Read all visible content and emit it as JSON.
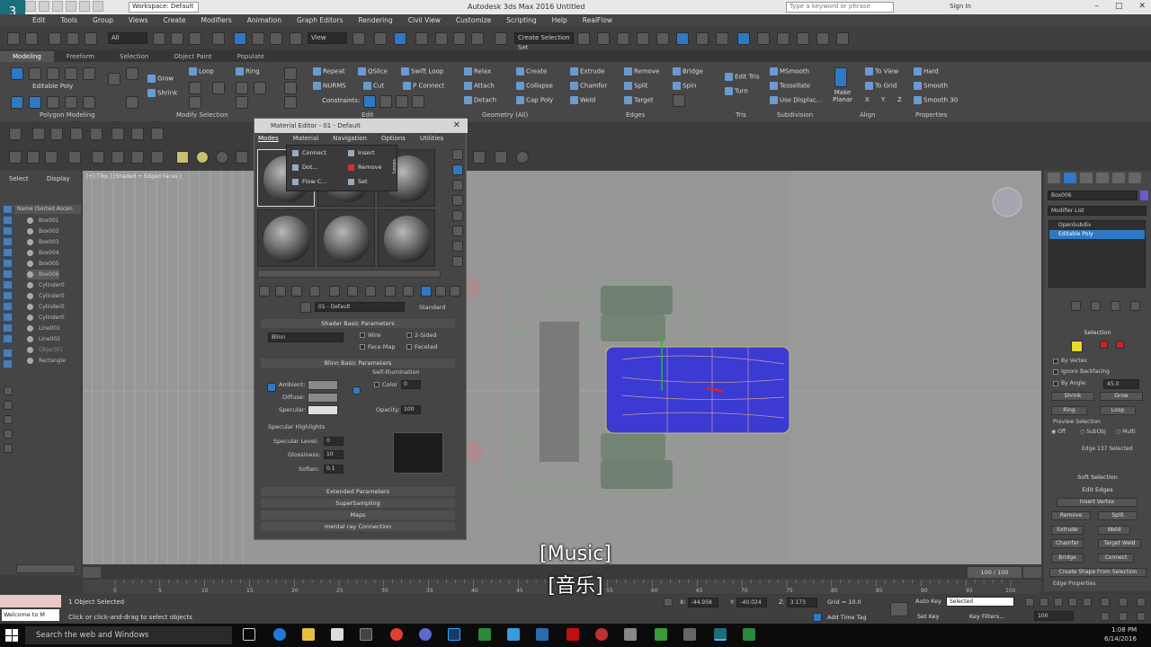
{
  "titlebar": {
    "workspace": "Workspace: Default",
    "title": "Autodesk 3ds Max 2016    Untitled",
    "search_placeholder": "Type a keyword or phrase",
    "signin": "Sign In"
  },
  "menu": [
    "Edit",
    "Tools",
    "Group",
    "Views",
    "Create",
    "Modifiers",
    "Animation",
    "Graph Editors",
    "Rendering",
    "Civil View",
    "Customize",
    "Scripting",
    "Help",
    "RealFlow"
  ],
  "toolbar": {
    "selection_filter": "All",
    "view": "View",
    "named_sel": "Create Selection Set"
  },
  "ribbon_tabs": [
    "Modeling",
    "Freeform",
    "Selection",
    "Object Paint",
    "Populate"
  ],
  "ribbon": {
    "editable_poly": "Editable Poly",
    "grow": "Grow",
    "shrink": "Shrink",
    "loop": "Loop",
    "ring": "Ring",
    "repeat": "Repeat",
    "qslice": "QSlice",
    "swift_loop": "Swift Loop",
    "nurms": "NURMS",
    "cut": "Cut",
    "p_connect": "P Connect",
    "constraints": "Constraints:",
    "relax": "Relax",
    "create": "Create",
    "attach": "Attach",
    "collapse": "Collapse",
    "detach": "Detach",
    "cap_poly": "Cap Poly",
    "extrude": "Extrude",
    "remove": "Remove",
    "bridge": "Bridge",
    "chamfer": "Chamfer",
    "split": "Split",
    "spin": "Spin",
    "weld": "Weld",
    "target": "Target",
    "edit_tris": "Edit Tris",
    "turn": "Turn",
    "msmooth": "MSmooth",
    "tessellate": "Tessellate",
    "use_displace": "Use Displac...",
    "make_planar": "Make Planar",
    "to_view": "To View",
    "to_grid": "To Grid",
    "x": "X",
    "y": "Y",
    "z": "Z",
    "hard": "Hard",
    "smooth": "Smooth",
    "smooth30": "Smooth 30",
    "foot_poly": "Polygon Modeling",
    "foot_modsel": "Modify Selection",
    "foot_edit": "Edit",
    "foot_geom": "Geometry (All)",
    "foot_edges": "Edges",
    "foot_tris": "Tris",
    "foot_subdiv": "Subdivision",
    "foot_align": "Align",
    "foot_props": "Properties"
  },
  "scene": {
    "tab_select": "Select",
    "tab_display": "Display",
    "column": "Name (Sorted Ascen",
    "items": [
      "Box001",
      "Box002",
      "Box003",
      "Box004",
      "Box005",
      "Box006",
      "Cylinder0",
      "Cylinder0",
      "Cylinder0",
      "Cylinder0",
      "Line001",
      "Line002",
      "Object01",
      "Rectangle"
    ]
  },
  "viewport": {
    "label": "[+] [Top ] [Shaded + Edged Faces ]"
  },
  "material_editor": {
    "title": "Material Editor - 01 - Default",
    "menus": [
      "Modes",
      "Material",
      "Navigation",
      "Options",
      "Utilities"
    ],
    "popup": {
      "connect": "Connect",
      "insert": "Insert",
      "dot": "Dot...",
      "remove": "Remove",
      "flow": "Flow C...",
      "set": "Set",
      "loops": "Loops"
    },
    "material_name": "01 - Default",
    "material_type": "Standard",
    "shader_section": "Shader Basic Parameters",
    "shader": "Blinn",
    "wire": "Wire",
    "two_sided": "2-Sided",
    "face_map": "Face Map",
    "faceted": "Faceted",
    "blinn_section": "Blinn Basic Parameters",
    "self_illum": "Self-Illumination",
    "color": "Color",
    "color_val": "0",
    "ambient": "Ambient:",
    "diffuse": "Diffuse:",
    "specular": "Specular:",
    "opacity": "Opacity:",
    "opacity_val": "100",
    "spec_highlights": "Specular Highlights",
    "spec_level": "Specular Level:",
    "spec_level_val": "0",
    "glossiness": "Glossiness:",
    "gloss_val": "10",
    "soften": "Soften:",
    "soften_val": "0.1",
    "extended": "Extended Parameters",
    "supersampling": "SuperSampling",
    "maps": "Maps",
    "mental_ray": "mental ray Connection"
  },
  "command_panel": {
    "object_name": "Box006",
    "modifier_list": "Modifier List",
    "stack": [
      "OpenSubdiv",
      "Editable Poly"
    ],
    "selection": "Selection",
    "by_vertex": "By Vertex",
    "ignore_backfacing": "Ignore Backfacing",
    "by_angle": "By Angle:",
    "angle_val": "45.0",
    "shrink": "Shrink",
    "grow": "Grow",
    "ring": "Ring",
    "loop": "Loop",
    "preview": "Preview Selection",
    "off": "Off",
    "subobj": "SubObj",
    "multi": "Multi",
    "edge_selected": "Edge 137 Selected",
    "soft_selection": "Soft Selection",
    "edit_edges": "Edit Edges",
    "insert_vertex": "Insert Vertex",
    "remove": "Remove",
    "split": "Split",
    "extrude": "Extrude",
    "weld": "Weld",
    "chamfer": "Chamfer",
    "target_weld": "Target Weld",
    "bridge": "Bridge",
    "connect": "Connect",
    "create_shape": "Create Shape From Selection",
    "edge_props": "Edge Properties"
  },
  "timeline": {
    "frame": "100 / 100",
    "ticks": [
      "0",
      "5",
      "10",
      "15",
      "20",
      "25",
      "30",
      "35",
      "40",
      "45",
      "50",
      "55",
      "60",
      "65",
      "70",
      "75",
      "80",
      "85",
      "90",
      "95",
      "100"
    ]
  },
  "status": {
    "script": "Welcome to M",
    "objects": "1 Object Selected",
    "prompt": "Click or click-and-drag to select objects",
    "x": "-44.958",
    "y": "-40.024",
    "z": "3.173",
    "grid": "Grid = 10.0",
    "add_time_tag": "Add Time Tag",
    "auto_key": "Auto Key",
    "selected": "Selected",
    "set_key": "Set Key",
    "key_filters": "Key Filters...",
    "frame": "100"
  },
  "taskbar": {
    "search": "Search the web and Windows",
    "time": "1:08 PM",
    "date": "6/14/2016"
  },
  "subtitles": {
    "line1": "[Music]",
    "line2": "[音乐]"
  }
}
